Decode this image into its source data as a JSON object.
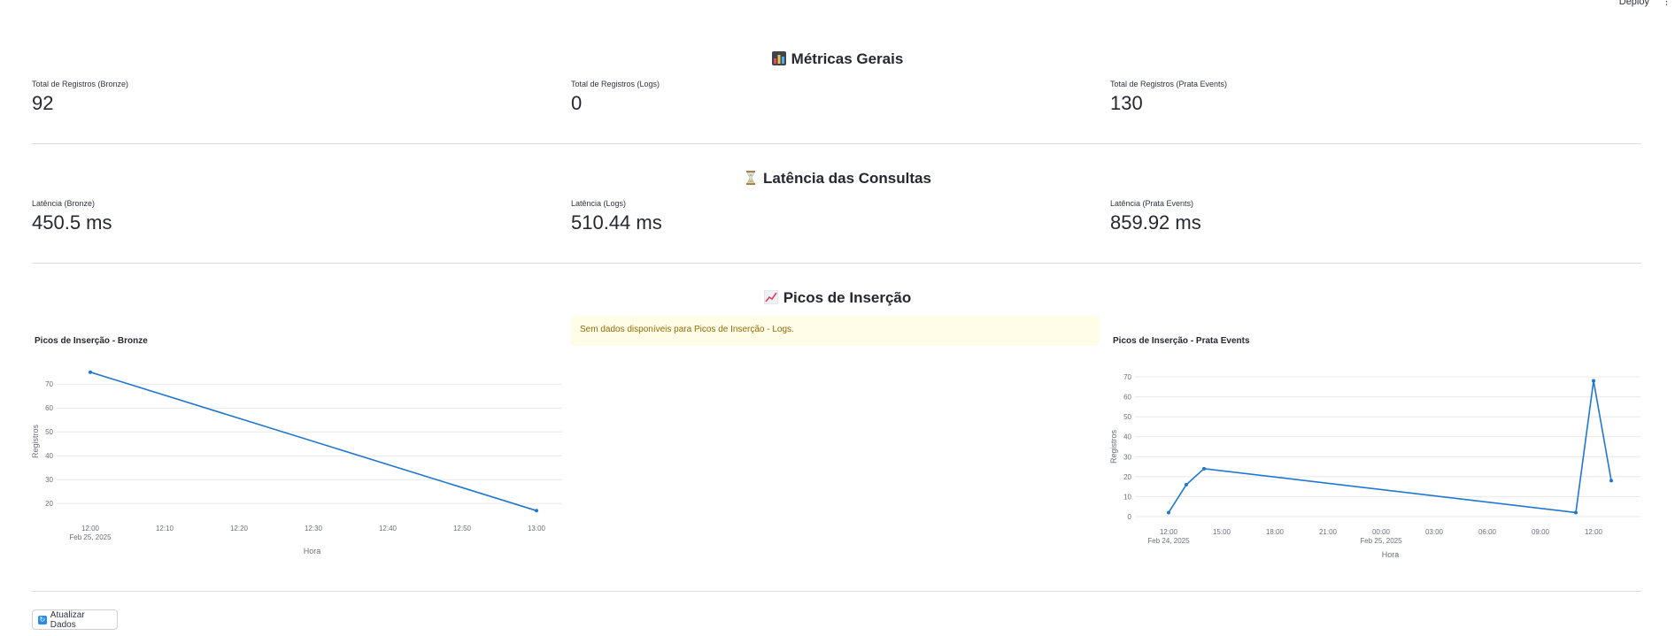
{
  "topbar": {
    "deploy_label": "Deploy",
    "menu_glyph": "⋮"
  },
  "sections": {
    "metricas": {
      "title": "Métricas Gerais",
      "icon": "bar-chart-icon"
    },
    "latencia": {
      "title": "Latência das Consultas",
      "icon": "hourglass-icon"
    },
    "picos": {
      "title": "Picos de Inserção",
      "icon": "chart-increasing-icon"
    }
  },
  "metrics": [
    {
      "label": "Total de Registros (Bronze)",
      "value": "92"
    },
    {
      "label": "Total de Registros (Logs)",
      "value": "0"
    },
    {
      "label": "Total de Registros (Prata Events)",
      "value": "130"
    }
  ],
  "latency": [
    {
      "label": "Latência (Bronze)",
      "value": "450.5 ms"
    },
    {
      "label": "Latência (Logs)",
      "value": "510.44 ms"
    },
    {
      "label": "Latência (Prata Events)",
      "value": "859.92 ms"
    }
  ],
  "alert": {
    "text": "Sem dados disponíveis para Picos de Inserção - Logs."
  },
  "refresh_button": {
    "label": "Atualizar Dados"
  },
  "colors": {
    "line": "#1f77d0",
    "grid": "#e8e8e8",
    "axis_text": "#6c6f78"
  },
  "chart_data": [
    {
      "type": "line",
      "title": "Picos de Inserção - Bronze",
      "xlabel": "Hora",
      "ylabel": "Registros",
      "x_ticks": [
        "12:00",
        "12:10",
        "12:20",
        "12:30",
        "12:40",
        "12:50",
        "13:00"
      ],
      "x_sublabel": "Feb 25, 2025",
      "y_ticks": [
        20,
        30,
        40,
        50,
        60,
        70
      ],
      "ylim": [
        16,
        76
      ],
      "xlim": [
        0,
        60
      ],
      "series": [
        {
          "x": [
            0,
            60
          ],
          "y": [
            75,
            17
          ]
        }
      ]
    },
    {
      "type": "line",
      "title": "Picos de Inserção - Prata Events",
      "xlabel": "Hora",
      "ylabel": "Registros",
      "x_ticks": [
        "12:00",
        "15:00",
        "18:00",
        "21:00",
        "00:00",
        "03:00",
        "06:00",
        "09:00",
        "12:00"
      ],
      "x_sublabel_first": "Feb 24, 2025",
      "x_sublabel_mid": "Feb 25, 2025",
      "y_ticks": [
        0,
        10,
        20,
        30,
        40,
        50,
        60,
        70
      ],
      "ylim": [
        0,
        70
      ],
      "xlim": [
        0,
        24
      ],
      "series": [
        {
          "x": [
            0,
            1,
            2,
            23,
            24,
            25
          ],
          "y": [
            2,
            16,
            24,
            2,
            68,
            18
          ]
        }
      ]
    }
  ]
}
